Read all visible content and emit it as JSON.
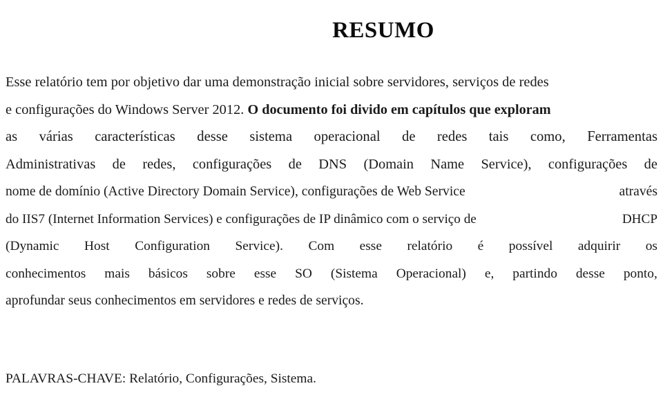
{
  "document": {
    "title": "RESUMO",
    "language": "pt-BR",
    "page_background": "#ffffff",
    "text_color": "#1a1a1a"
  },
  "abstract": {
    "lines": [
      {
        "id": "line-1",
        "justified": false,
        "text": "Esse relatório tem por objetivo dar uma demonstração inicial sobre servidores, serviços de redes",
        "words": [
          "Esse",
          "relatório",
          "tem",
          "por",
          "objetivo",
          "dar",
          "uma",
          "demonstração",
          "inicial",
          "sobre",
          "servidores,",
          "serviços",
          "de",
          "redes"
        ]
      },
      {
        "id": "line-2",
        "justified": false,
        "text": "e configurações do Windows Server 2012. O documento foi divido em capítulos que exploram",
        "segment_regular": "e configurações do Windows Server 2012. ",
        "segment_emphasis": "O documento foi divido em capítulos que exploram",
        "words": [
          "e",
          "configurações",
          "do",
          "Windows",
          "Server",
          "2012.",
          "O",
          "documento",
          "foi",
          "divido",
          "em",
          "capítulos",
          "que",
          "exploram"
        ]
      },
      {
        "id": "line-3",
        "justified": true,
        "text": "as várias características desse sistema operacional de redes tais como, Ferramentas",
        "words": [
          "as",
          "várias",
          "características",
          "desse",
          "sistema",
          "operacional",
          "de",
          "redes",
          "tais",
          "como,",
          "Ferramentas"
        ]
      },
      {
        "id": "line-4",
        "justified": true,
        "text": "Administrativas de redes, configurações de DNS (Domain Name Service), configurações de",
        "words": [
          "Administrativas",
          "de",
          "redes,",
          "configurações",
          "de",
          "DNS",
          "(Domain",
          "Name",
          "Service),",
          "configurações",
          "de"
        ]
      },
      {
        "id": "line-5",
        "justified": true,
        "text": "nome de domínio (Active Directory Domain Service), configurações de Web Service através",
        "words": [
          "nome de domínio (Active Directory Domain Service), configurações de Web Service",
          "através"
        ]
      },
      {
        "id": "line-6",
        "justified": true,
        "text": "do IIS7 (Internet Information Services) e configurações de IP dinâmico com o serviço de DHCP",
        "words": [
          "do IIS7 (Internet Information Services) e configurações de IP dinâmico com o serviço de",
          "DHCP"
        ]
      },
      {
        "id": "line-7",
        "justified": true,
        "text": "(Dynamic Host Configuration Service). Com esse relatório é possível adquirir os",
        "words": [
          "(Dynamic",
          "Host",
          "Configuration",
          "Service).",
          "Com",
          "esse",
          "relatório",
          "é",
          "possível",
          "adquirir",
          "os"
        ]
      },
      {
        "id": "line-8",
        "justified": true,
        "text": "conhecimentos mais básicos sobre esse SO (Sistema Operacional) e, partindo desse ponto,",
        "words": [
          "conhecimentos",
          "mais",
          "básicos",
          "sobre",
          "esse",
          "SO",
          "(Sistema",
          "Operacional)",
          "e,",
          "partindo",
          "desse",
          "ponto,"
        ]
      },
      {
        "id": "line-9",
        "justified": false,
        "text": "aprofundar seus conhecimentos em servidores e redes de serviços.",
        "words": [
          "aprofundar",
          "seus",
          "conhecimentos",
          "em",
          "servidores",
          "e",
          "redes",
          "de",
          "serviços."
        ]
      }
    ]
  },
  "keywords": {
    "label": "PALAVRAS-CHAVE:",
    "values": "Relatório, Configurações, Sistema.",
    "full_text": "PALAVRAS-CHAVE: Relatório, Configurações, Sistema."
  }
}
